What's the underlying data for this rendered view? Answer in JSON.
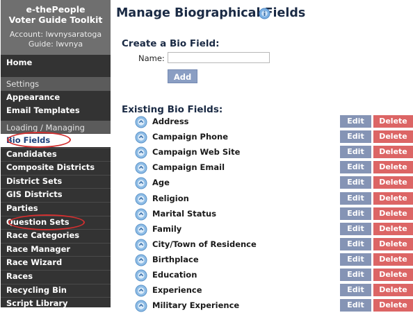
{
  "sidebar": {
    "title_line1": "e-thePeople",
    "title_line2": "Voter Guide Toolkit",
    "account_line": "Account: lwvnysaratoga",
    "guide_line": "Guide: lwvnya",
    "home": "Home",
    "settings_section": "Settings",
    "settings_items": [
      "Appearance",
      "Email Templates"
    ],
    "loading_section": "Loading / Managing",
    "loading_items": [
      "Bio Fields",
      "Candidates",
      "Composite Districts",
      "District Sets",
      "GIS Districts",
      "Parties",
      "Question Sets",
      "Race Categories",
      "Race Manager",
      "Race Wizard",
      "Races",
      "Recycling Bin",
      "Script Library"
    ],
    "selected_item": "Bio Fields",
    "annotation_color": "#d32f2f"
  },
  "main": {
    "title": "Manage Biographical Fields",
    "help_icon": "help-icon",
    "create_heading": "Create a Bio Field:",
    "name_label": "Name:",
    "name_value": "",
    "add_label": "Add",
    "existing_heading": "Existing Bio Fields:",
    "edit_label": "Edit",
    "delete_label": "Delete",
    "fields": [
      "Address",
      "Campaign Phone",
      "Campaign Web Site",
      "Campaign Email",
      "Age",
      "Religion",
      "Marital Status",
      "Family",
      "City/Town of Residence",
      "Birthplace",
      "Education",
      "Experience",
      "Military Experience"
    ]
  },
  "colors": {
    "sidebar_bg": "#333333",
    "header_bg": "#6f6f6f",
    "section_bg": "#5b5b5b",
    "edit_bg": "#8594b5",
    "delete_bg": "#dc6565",
    "add_bg": "#8a9ec3"
  }
}
